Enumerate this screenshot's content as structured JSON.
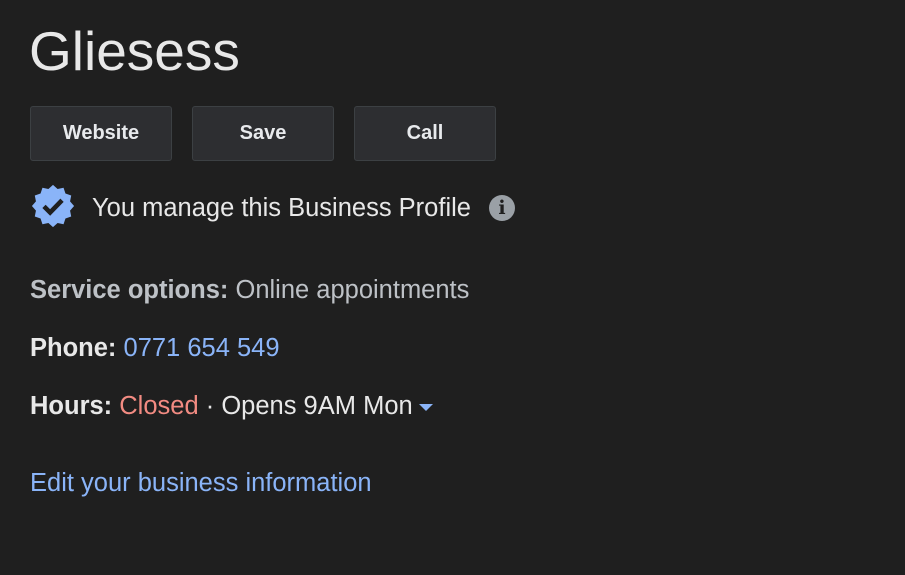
{
  "business": {
    "name": "Gliesess"
  },
  "actions": [
    {
      "label": "Website"
    },
    {
      "label": "Save"
    },
    {
      "label": "Call"
    }
  ],
  "managed": {
    "text": "You manage this Business Profile",
    "badge_icon": "verified-badge-icon",
    "info_icon": "info-icon",
    "badge_color": "#8ab4f8"
  },
  "details": {
    "service_label": "Service options:",
    "service_value": "Online appointments",
    "phone_label": "Phone:",
    "phone_value": "0771 654 549",
    "hours_label": "Hours:",
    "hours_status": "Closed",
    "hours_separator": "·",
    "hours_next": "Opens 9AM Mon"
  },
  "edit_link": "Edit your business information",
  "colors": {
    "background": "#1f1f1f",
    "link": "#8ab4f8",
    "closed": "#f28b82"
  }
}
